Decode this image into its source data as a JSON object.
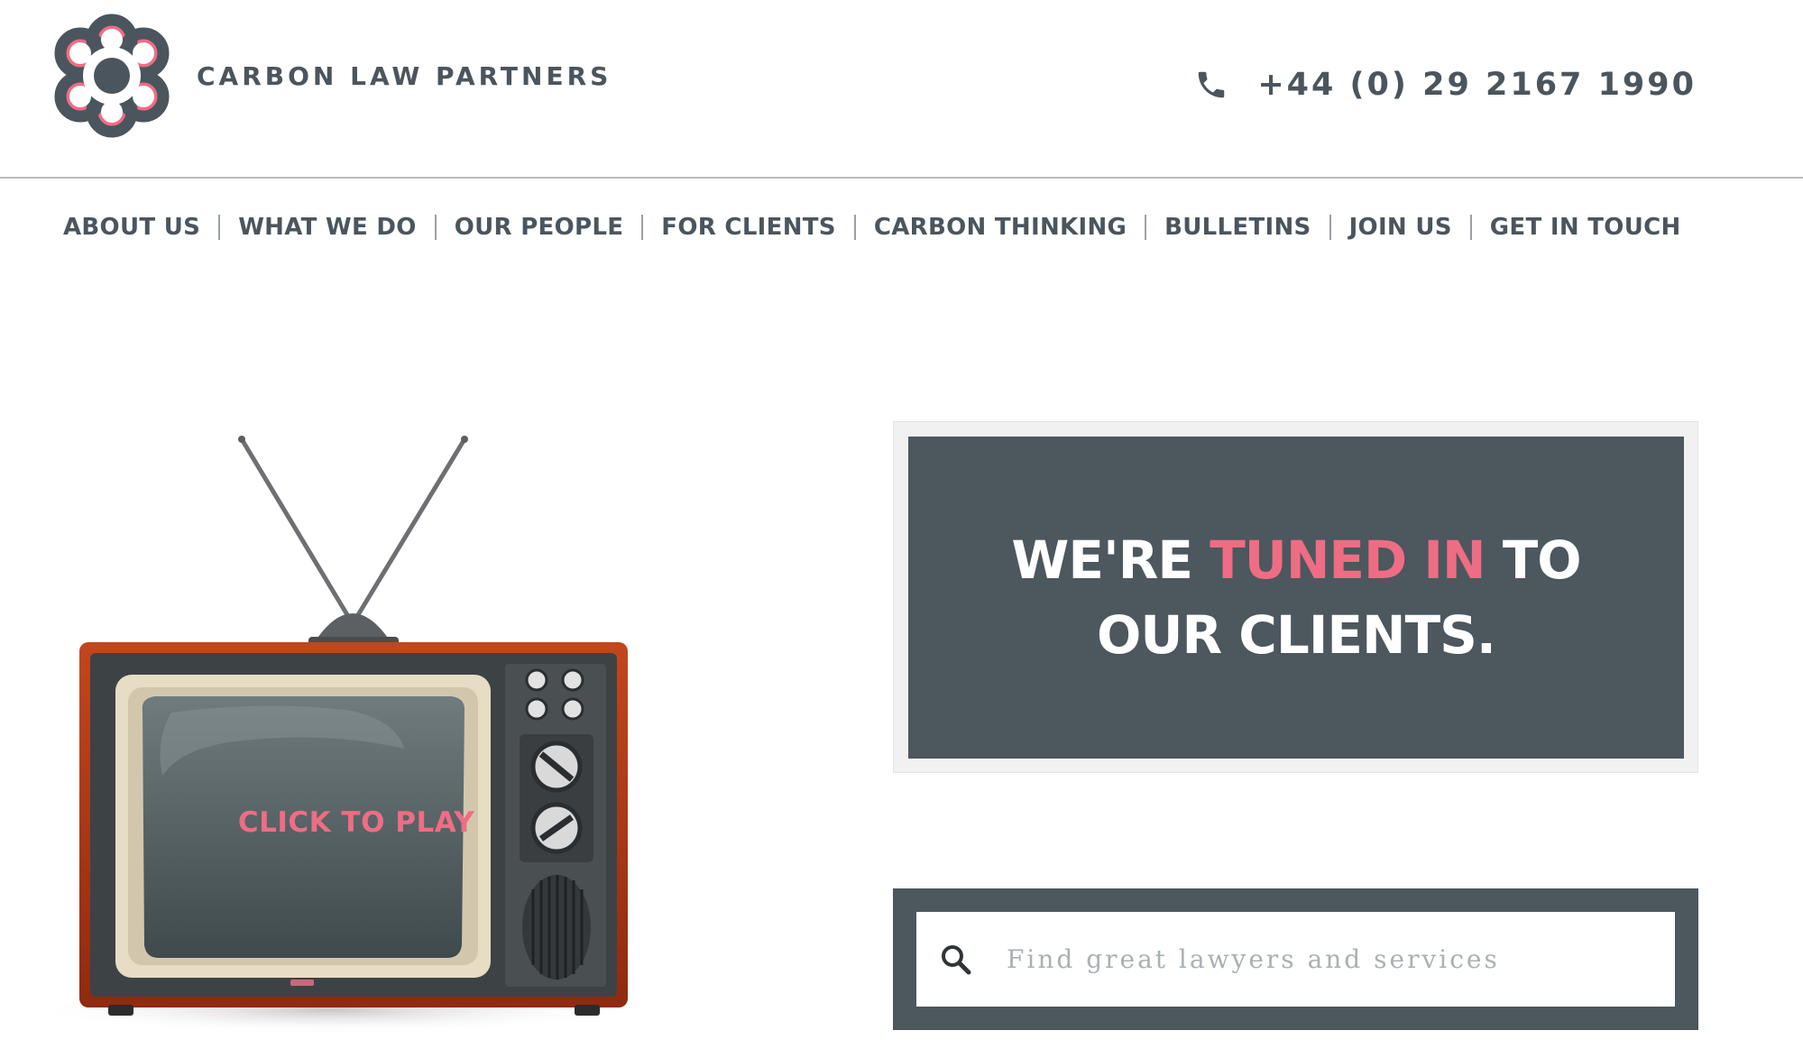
{
  "brand": {
    "name": "CARBON LAW PARTNERS",
    "logo_icon": "flower-logo-icon",
    "colors": {
      "primary": "#4b555d",
      "accent": "#ee6d84"
    }
  },
  "contact": {
    "phone_icon": "phone-icon",
    "phone": "+44 (0) 29 2167 1990"
  },
  "nav": {
    "items": [
      "ABOUT US",
      "WHAT WE DO",
      "OUR PEOPLE",
      "FOR CLIENTS",
      "CARBON THINKING",
      "BULLETINS",
      "JOIN US",
      "GET IN TOUCH"
    ]
  },
  "video": {
    "play_label": "CLICK TO PLAY",
    "image": "retro-television"
  },
  "tagline": {
    "part1": "WE'RE ",
    "highlight": "TUNED IN",
    "part2": " TO",
    "line2": "OUR CLIENTS."
  },
  "search": {
    "icon": "search-icon",
    "placeholder": "Find great lawyers and services",
    "value": ""
  }
}
